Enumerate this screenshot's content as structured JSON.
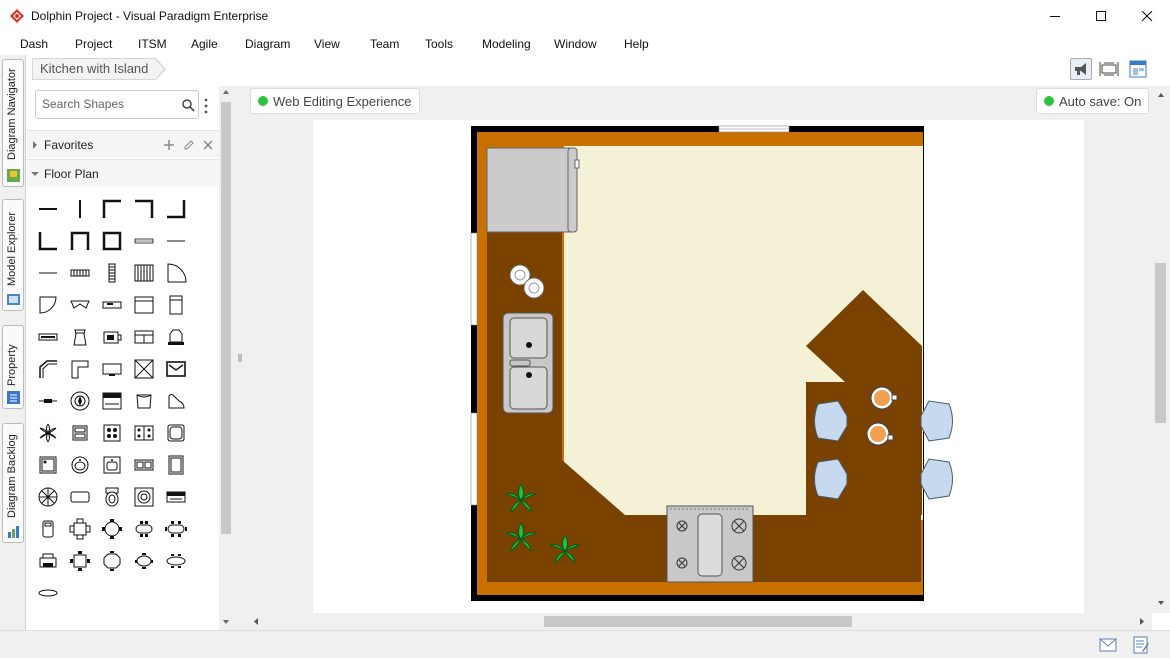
{
  "window": {
    "title": "Dolphin Project - Visual Paradigm Enterprise",
    "controls": [
      "minimize",
      "maximize",
      "close"
    ]
  },
  "menu": [
    "Dash",
    "Project",
    "ITSM",
    "Agile",
    "Diagram",
    "View",
    "Team",
    "Tools",
    "Modeling",
    "Window",
    "Help"
  ],
  "side_tabs": [
    "Diagram Navigator",
    "Model Explorer",
    "Property",
    "Diagram Backlog"
  ],
  "breadcrumb": {
    "diagram": "Kitchen with Island"
  },
  "shapes_panel": {
    "search_placeholder": "Search Shapes",
    "favorites": "Favorites",
    "floor_plan": "Floor Plan"
  },
  "canvas": {
    "web_editing": "Web Editing Experience",
    "auto_save": "Auto save: On"
  },
  "icons": {
    "app": "vp-logo-icon",
    "search": "search-icon",
    "more": "kebab-menu-icon",
    "add": "plus-icon",
    "edit": "pencil-icon",
    "remove": "close-icon",
    "status_left": "mail-icon",
    "status_right": "notes-icon",
    "toolbar": [
      "megaphone-icon",
      "fit-diagram-icon",
      "layout-icon"
    ]
  },
  "colors": {
    "wall": "#000000",
    "floor": "#f5f1d6",
    "counter_edge": "#c87000",
    "counter": "#7a4200",
    "status_green": "#2fc140"
  }
}
